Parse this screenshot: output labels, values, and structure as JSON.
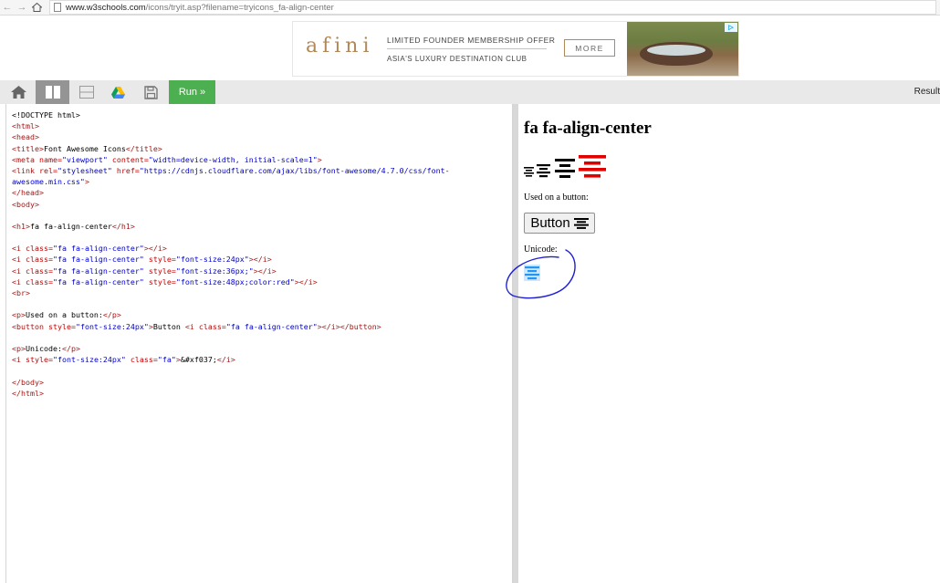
{
  "browser": {
    "url_domain": "www.w3schools.com",
    "url_path": "/icons/tryit.asp?filename=tryicons_fa-align-center"
  },
  "ad": {
    "brand": "afini",
    "line1": "LIMITED FOUNDER MEMBERSHIP OFFER",
    "line2": "ASIA'S LUXURY DESTINATION CLUB",
    "cta": "MORE"
  },
  "toolbar": {
    "run_label": "Run »",
    "result_label": "Result"
  },
  "editor": {
    "lines": [
      [
        [
          "tx",
          "<!DOCTYPE html>"
        ]
      ],
      [
        [
          "tg",
          "<html>"
        ]
      ],
      [
        [
          "tg",
          "<head>"
        ]
      ],
      [
        [
          "tg",
          "<title>"
        ],
        [
          "tx",
          "Font Awesome Icons"
        ],
        [
          "tg",
          "</title>"
        ]
      ],
      [
        [
          "tg",
          "<meta "
        ],
        [
          "at",
          "name="
        ],
        [
          "av",
          "\"viewport\""
        ],
        [
          "at",
          " content="
        ],
        [
          "av",
          "\"width=device-width, initial-scale=1\""
        ],
        [
          "tg",
          ">"
        ]
      ],
      [
        [
          "tg",
          "<link "
        ],
        [
          "at",
          "rel="
        ],
        [
          "av",
          "\"stylesheet\""
        ],
        [
          "at",
          " href="
        ],
        [
          "av",
          "\"https://cdnjs.cloudflare.com/ajax/libs/font-awesome/4.7.0/css/font-"
        ]
      ],
      [
        [
          "av",
          "awesome.min.css\""
        ],
        [
          "tg",
          ">"
        ]
      ],
      [
        [
          "tg",
          "</head>"
        ]
      ],
      [
        [
          "tg",
          "<body>"
        ]
      ],
      [
        [
          "tx",
          ""
        ]
      ],
      [
        [
          "tg",
          "<h1>"
        ],
        [
          "tx",
          "fa fa-align-center"
        ],
        [
          "tg",
          "</h1>"
        ]
      ],
      [
        [
          "tx",
          ""
        ]
      ],
      [
        [
          "tg",
          "<i "
        ],
        [
          "at",
          "class="
        ],
        [
          "av",
          "\"fa fa-align-center\""
        ],
        [
          "tg",
          "></i>"
        ]
      ],
      [
        [
          "tg",
          "<i "
        ],
        [
          "at",
          "class="
        ],
        [
          "av",
          "\"fa fa-align-center\""
        ],
        [
          "at",
          " style="
        ],
        [
          "av",
          "\"font-size:24px\""
        ],
        [
          "tg",
          "></i>"
        ]
      ],
      [
        [
          "tg",
          "<i "
        ],
        [
          "at",
          "class="
        ],
        [
          "av",
          "\"fa fa-align-center\""
        ],
        [
          "at",
          " style="
        ],
        [
          "av",
          "\"font-size:36px;\""
        ],
        [
          "tg",
          "></i>"
        ]
      ],
      [
        [
          "tg",
          "<i "
        ],
        [
          "at",
          "class="
        ],
        [
          "av",
          "\"fa fa-align-center\""
        ],
        [
          "at",
          " style="
        ],
        [
          "av",
          "\"font-size:48px;color:red\""
        ],
        [
          "tg",
          "></i>"
        ]
      ],
      [
        [
          "tg",
          "<br>"
        ]
      ],
      [
        [
          "tx",
          ""
        ]
      ],
      [
        [
          "tg",
          "<p>"
        ],
        [
          "tx",
          "Used on a button:"
        ],
        [
          "tg",
          "</p>"
        ]
      ],
      [
        [
          "tg",
          "<button "
        ],
        [
          "at",
          "style="
        ],
        [
          "av",
          "\"font-size:24px\""
        ],
        [
          "tg",
          ">"
        ],
        [
          "tx",
          "Button "
        ],
        [
          "tg",
          "<i "
        ],
        [
          "at",
          "class="
        ],
        [
          "av",
          "\"fa fa-align-center\""
        ],
        [
          "tg",
          "></i></button>"
        ]
      ],
      [
        [
          "tx",
          ""
        ]
      ],
      [
        [
          "tg",
          "<p>"
        ],
        [
          "tx",
          "Unicode:"
        ],
        [
          "tg",
          "</p>"
        ]
      ],
      [
        [
          "tg",
          "<i "
        ],
        [
          "at",
          "style="
        ],
        [
          "av",
          "\"font-size:24px\""
        ],
        [
          "at",
          " class="
        ],
        [
          "av",
          "\"fa\""
        ],
        [
          "tg",
          ">"
        ],
        [
          "tx",
          "&#xf037;"
        ],
        [
          "tg",
          "</i>"
        ]
      ],
      [
        [
          "tx",
          ""
        ]
      ],
      [
        [
          "tg",
          "</body>"
        ]
      ],
      [
        [
          "tg",
          "</html>"
        ]
      ]
    ]
  },
  "result": {
    "heading": "fa fa-align-center",
    "used_on_button": "Used on a button:",
    "button_label": "Button",
    "unicode_label": "Unicode:"
  },
  "colors": {
    "run_green": "#4caf50",
    "icon_red": "#e00000",
    "annotation_blue": "#1f1fd6",
    "selection_blue": "#2196f3"
  },
  "icons": [
    "home-icon",
    "two-columns-layout-icon",
    "two-rows-layout-icon",
    "google-drive-icon",
    "save-icon",
    "align-center-icon"
  ]
}
